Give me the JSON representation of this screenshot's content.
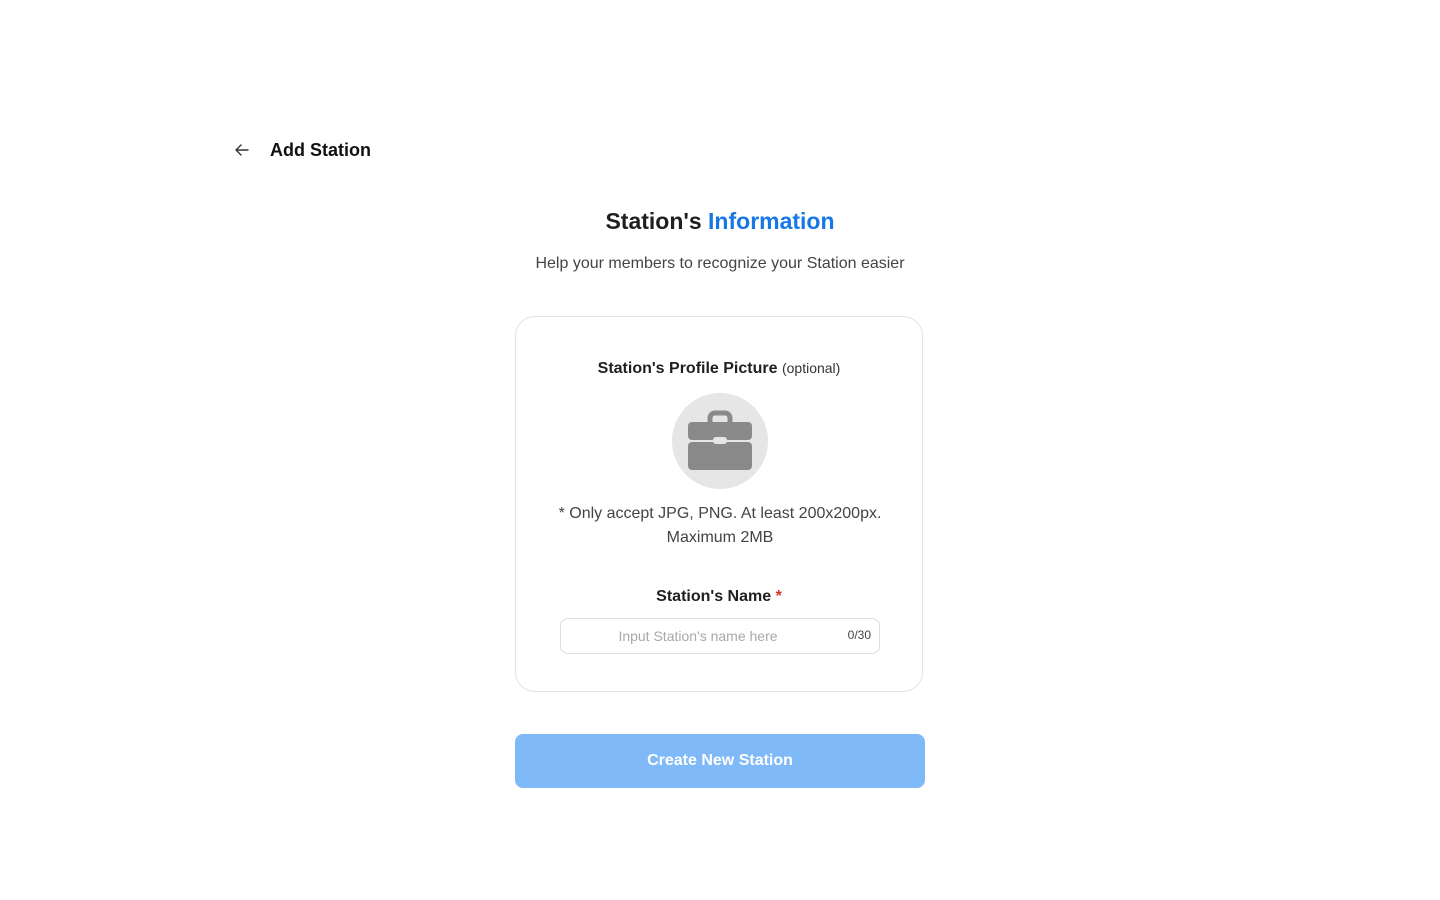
{
  "header": {
    "back_icon": "arrow-left-icon",
    "title": "Add Station"
  },
  "intro": {
    "heading_prefix": "Station's",
    "heading_accent": "Information",
    "subheading": "Help your members to recognize your Station easier",
    "accent_color": "#1677e5"
  },
  "form": {
    "picture": {
      "label": "Station's Profile Picture",
      "optional_label": "(optional)",
      "placeholder_icon": "briefcase-icon",
      "hint_line1": "* Only accept JPG, PNG. At least 200x200px.",
      "hint_line2": "Maximum 2MB"
    },
    "name": {
      "label": "Station's Name",
      "required_mark": "*",
      "value": "",
      "placeholder": "Input Station's name here",
      "counter": "0/30"
    }
  },
  "actions": {
    "create_label": "Create New Station",
    "create_color": "#80b9f7",
    "create_disabled": true
  }
}
